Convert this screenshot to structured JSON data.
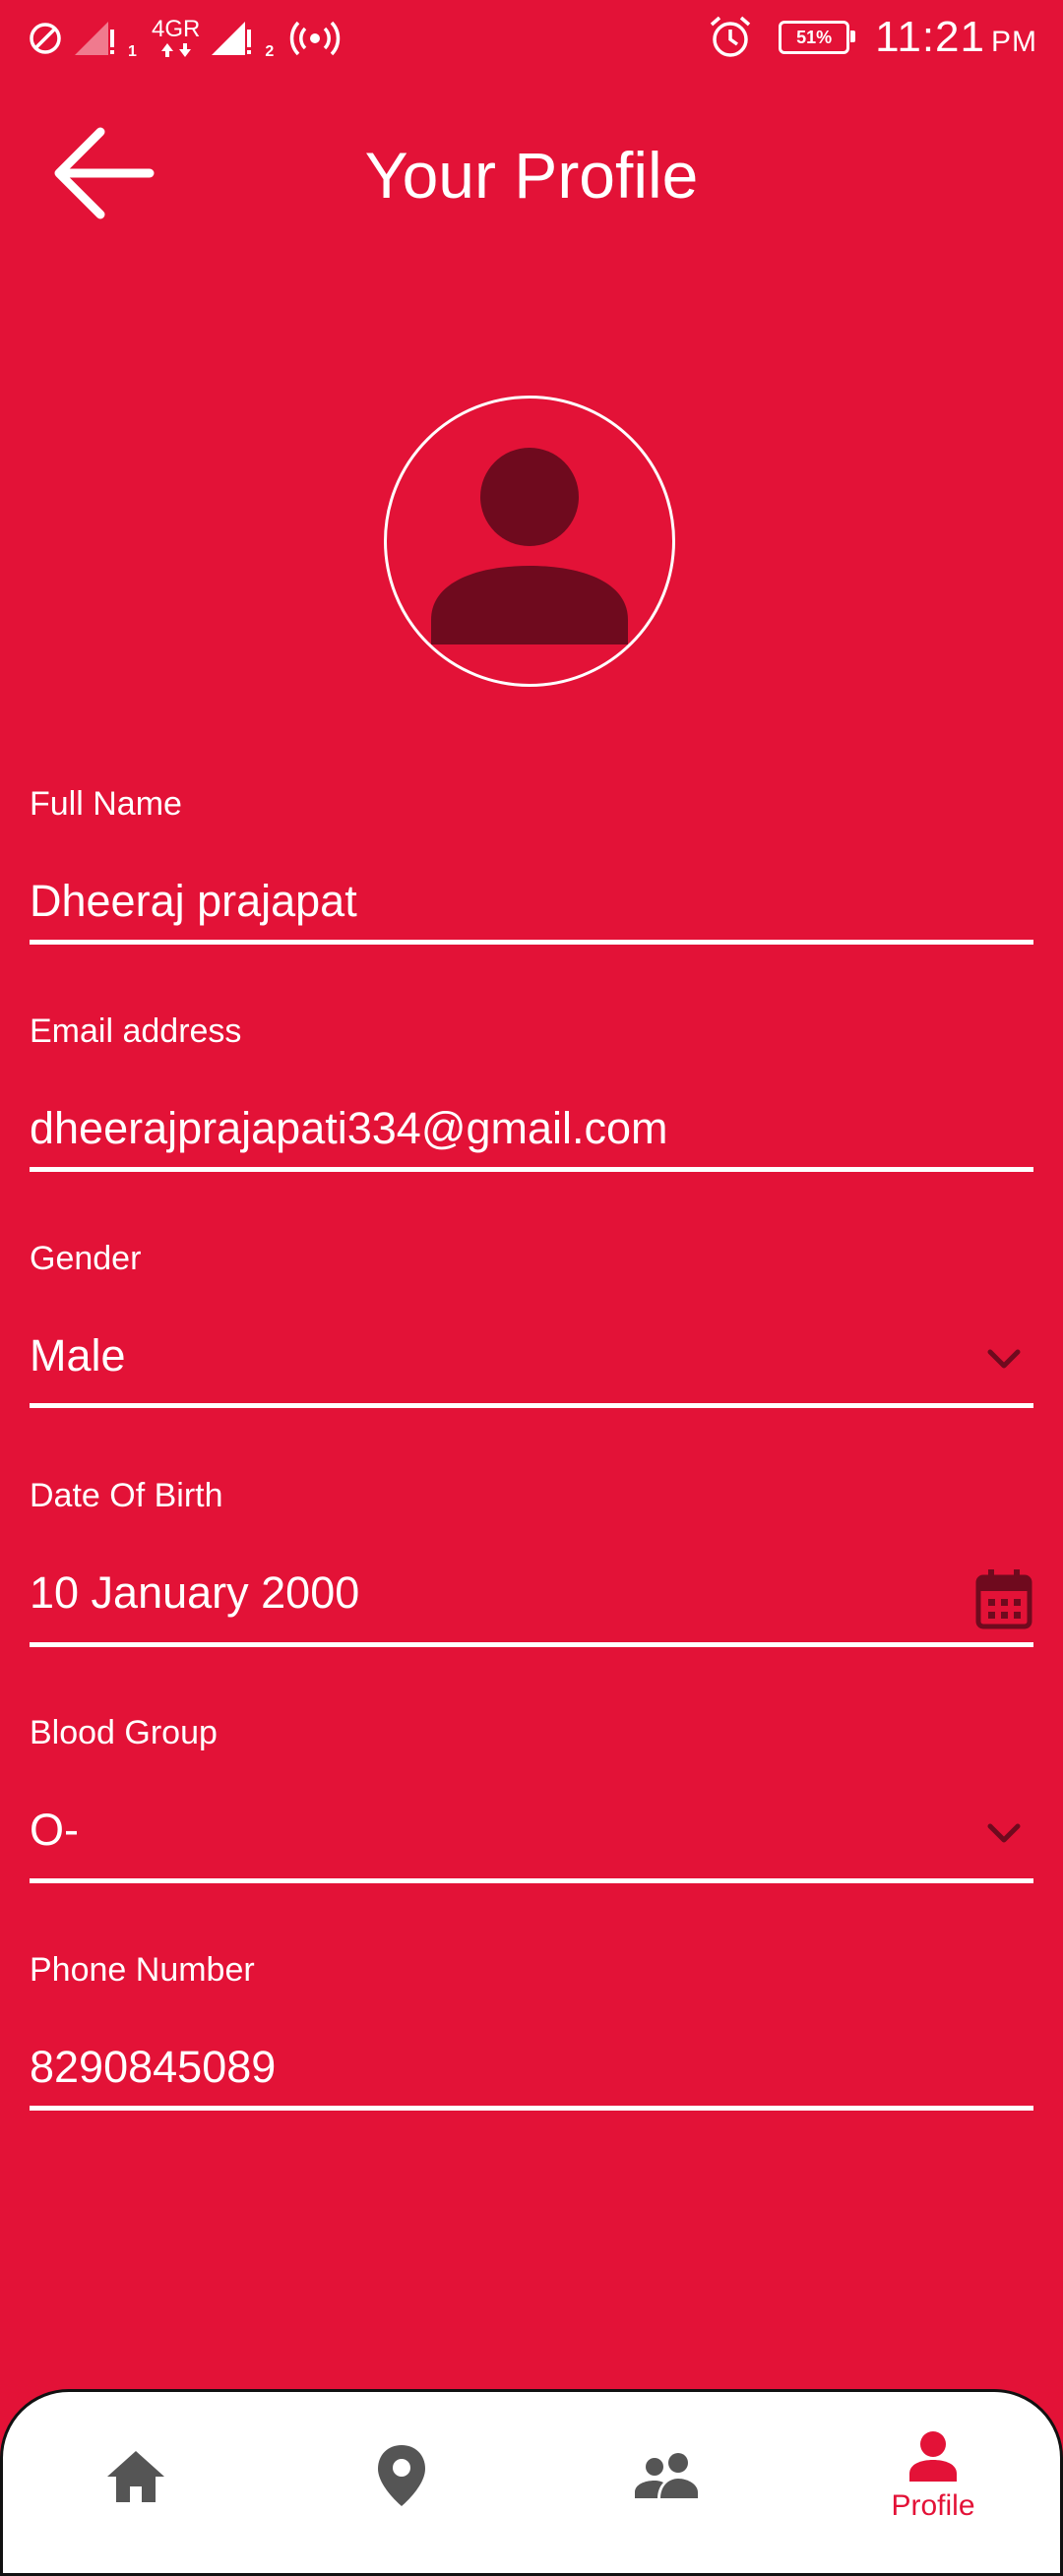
{
  "status_bar": {
    "network": "4GR",
    "sim1": "1",
    "sim2": "2",
    "battery": "51%",
    "time": "11:21",
    "ampm": "PM"
  },
  "header": {
    "title": "Your Profile",
    "back_icon": "arrow-back-icon"
  },
  "avatar": {
    "icon": "person-icon"
  },
  "form": {
    "full_name": {
      "label": "Full Name",
      "value": "Dheeraj prajapat"
    },
    "email": {
      "label": "Email address",
      "value": "dheerajprajapati334@gmail.com"
    },
    "gender": {
      "label": "Gender",
      "value": "Male",
      "icon": "chevron-down-icon"
    },
    "dob": {
      "label": "Date Of Birth",
      "value": "10 January 2000",
      "icon": "calendar-icon"
    },
    "blood_group": {
      "label": "Blood Group",
      "value": "O-",
      "icon": "chevron-down-icon"
    },
    "phone": {
      "label": "Phone Number",
      "value": "8290845089"
    }
  },
  "bottom_nav": {
    "items": [
      {
        "icon": "home-icon",
        "label": ""
      },
      {
        "icon": "location-pin-icon",
        "label": ""
      },
      {
        "icon": "people-icon",
        "label": ""
      },
      {
        "icon": "person-icon",
        "label": "Profile",
        "active": true
      }
    ]
  },
  "colors": {
    "primary": "#E31237",
    "avatar_fill": "#6F0A1E",
    "nav_icon_inactive": "#555555",
    "white": "#FFFFFF"
  }
}
